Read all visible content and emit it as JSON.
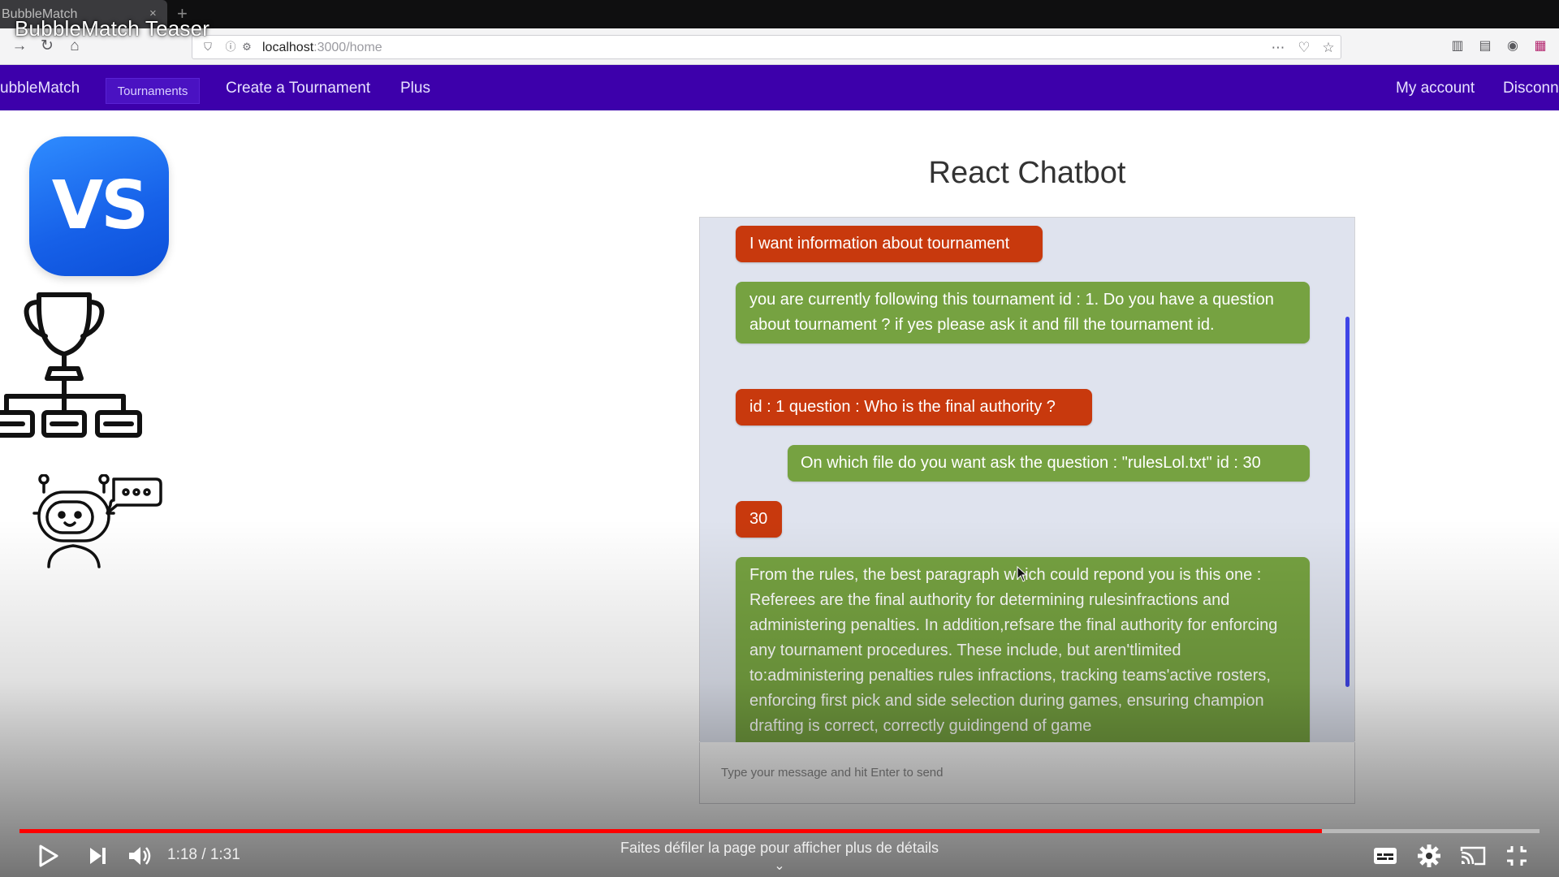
{
  "browser": {
    "tab_title": "BubbleMatch",
    "tab_close": "×",
    "new_tab": "+",
    "url_host": "localhost",
    "url_rest": ":3000/home"
  },
  "video": {
    "title": "BubbleMatch Teaser",
    "current_time": "1:18",
    "duration": "1:31",
    "time_display": "1:18 / 1:31",
    "progress": 0.857,
    "scroll_hint": "Faites défiler la page pour afficher plus de détails"
  },
  "navbar": {
    "brand": "ubbleMatch",
    "tournaments": "Tournaments",
    "create": "Create a Tournament",
    "plus": "Plus",
    "account": "My account",
    "disconnect": "Disconn"
  },
  "vs_badge": {
    "text": "VS"
  },
  "chat": {
    "title": "React Chatbot",
    "input_placeholder": "Type your message and hit Enter to send",
    "messages": [
      {
        "from": "user",
        "text": "I want information about tournament"
      },
      {
        "from": "bot",
        "text": "you are currently following this tournament id : 1. Do you have a question about tournament ? if yes please ask it and fill the tournament id."
      },
      {
        "from": "user",
        "text": "id : 1 question : Who is the final authority ?"
      },
      {
        "from": "bot",
        "text": "On which file do you want ask the question : \"rulesLol.txt\" id : 30"
      },
      {
        "from": "user",
        "text": "30"
      },
      {
        "from": "bot",
        "text": "From the rules, the best paragraph which could repond you is this one : Referees are the final authority for determining rulesinfractions and administering penalties. In addition,refsare the final authority for enforcing any tournament procedures. These include, but aren'tlimited to:administering penalties rules infractions, tracking teams'active rosters, enforcing first pick and side selection during games, ensuring champion drafting is correct, correctly guidingend of game"
      }
    ]
  },
  "colors": {
    "navbar": "#3d00ab",
    "user_bubble": "#c8390d",
    "bot_bubble": "#76a241",
    "chat_bg": "#dfe3ee",
    "progress": "#ff0000",
    "scrollbar": "#3f45e6"
  },
  "icons": {
    "back": "back-arrow-icon",
    "reload": "reload-icon",
    "home": "home-icon",
    "shield": "shield-icon",
    "info": "info-icon",
    "permissions": "permissions-icon",
    "more": "more-icon",
    "pocket": "pocket-icon",
    "bookmark": "star-icon",
    "library": "library-icon",
    "sidebar": "sidebar-icon",
    "account": "account-icon",
    "container": "container-icon",
    "trophy": "trophy-bracket-icon",
    "bot": "chatbot-icon",
    "play": "play-icon",
    "next": "next-icon",
    "volume": "volume-icon",
    "subtitles": "subtitles-icon",
    "settings": "gear-icon",
    "cast": "cast-icon",
    "exit_fullscreen": "exit-fullscreen-icon"
  }
}
